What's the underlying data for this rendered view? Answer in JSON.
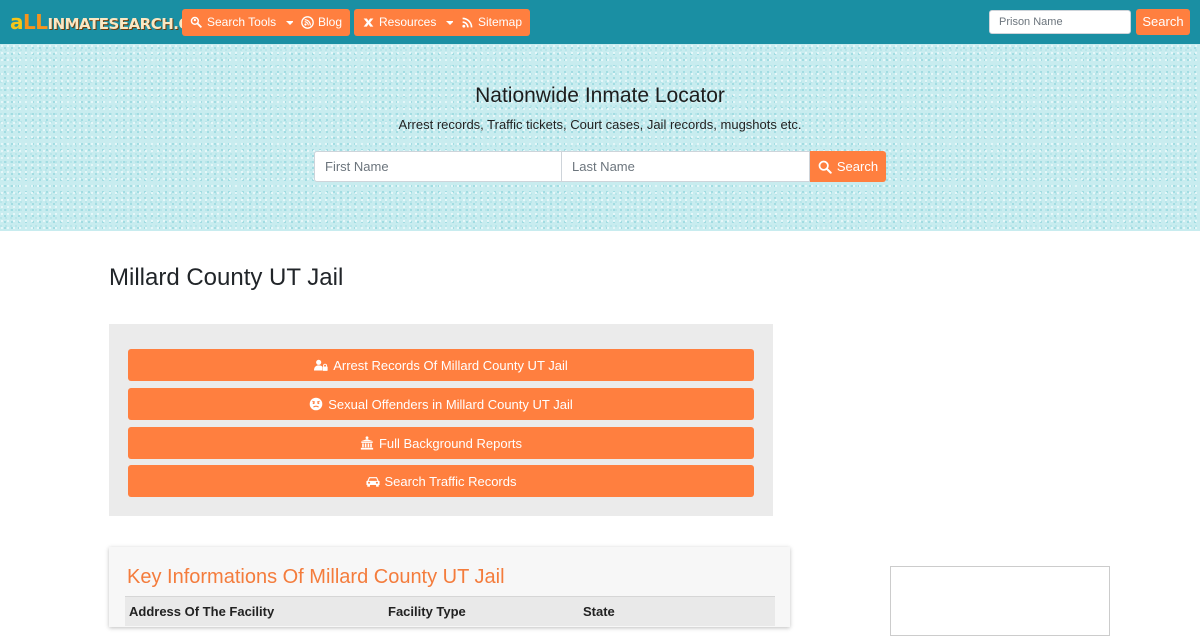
{
  "navbar": {
    "logo_a": "a",
    "logo_l": "LL",
    "logo_rest": "INMATESEARCH.ORG",
    "items": [
      {
        "label": "Search Tools",
        "icon": "search-user-icon",
        "dropdown": true
      },
      {
        "label": "Blog",
        "icon": "blog-icon",
        "dropdown": false
      },
      {
        "label": "Resources",
        "icon": "resources-icon",
        "dropdown": true
      },
      {
        "label": "Sitemap",
        "icon": "rss-icon",
        "dropdown": false
      }
    ],
    "prison_search": {
      "placeholder": "Prison Name",
      "button": "Search"
    }
  },
  "hero": {
    "title": "Nationwide Inmate Locator",
    "subtitle": "Arrest records, Traffic tickets, Court cases, Jail records, mugshots etc.",
    "first_placeholder": "First Name",
    "last_placeholder": "Last Name",
    "button": "Search"
  },
  "page": {
    "title": "Millard County UT Jail"
  },
  "action_buttons": [
    {
      "label": "Arrest Records Of Millard County UT Jail",
      "icon": "user-lock-icon"
    },
    {
      "label": "Sexual Offenders in Millard County UT Jail",
      "icon": "angry-face-icon"
    },
    {
      "label": "Full Background Reports",
      "icon": "courthouse-icon"
    },
    {
      "label": "Search Traffic Records",
      "icon": "car-icon"
    }
  ],
  "info": {
    "title": "Key Informations Of Millard County UT Jail",
    "columns": [
      "Address Of The Facility",
      "Facility Type",
      "State"
    ]
  },
  "colors": {
    "navbar": "#1a8fa3",
    "accent": "#ff7f3f",
    "info_title": "#f47c3c"
  }
}
